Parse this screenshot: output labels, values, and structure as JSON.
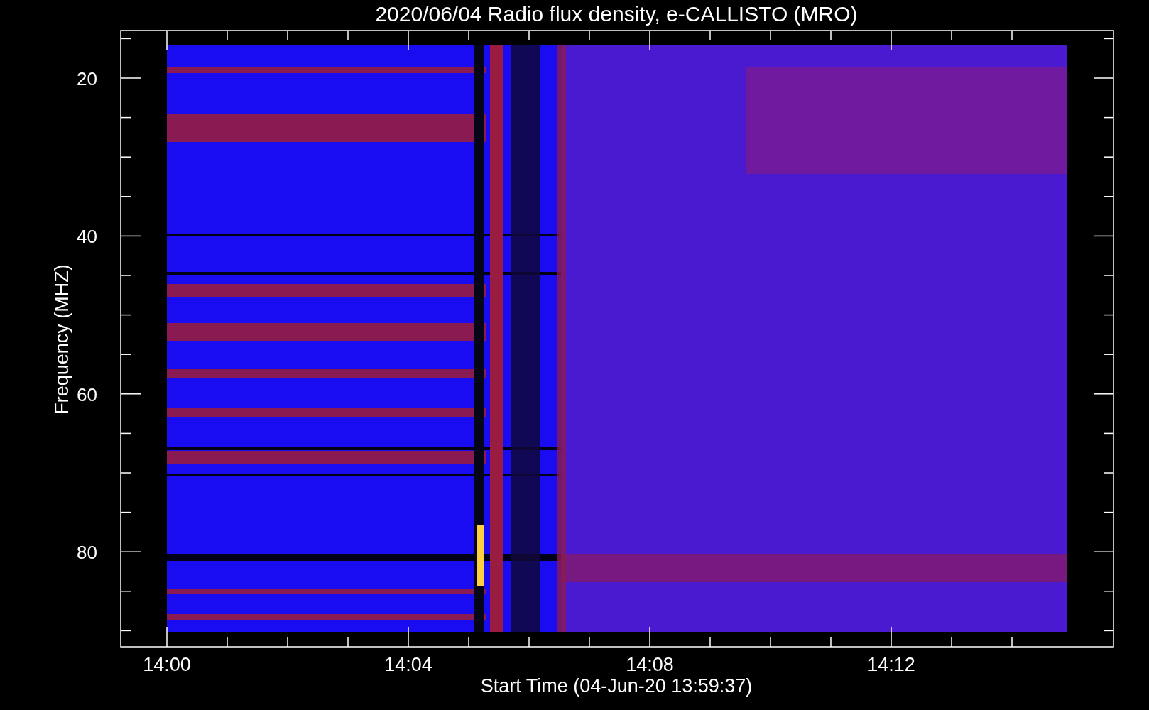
{
  "title": "2020/06/04  Radio flux density, e-CALLISTO (MRO)",
  "y_axis": {
    "label": "Frequency (MHZ)",
    "ticks": [
      "20",
      "40",
      "60",
      "80"
    ]
  },
  "x_axis": {
    "label": "Start Time (04-Jun-20 13:59:37)",
    "ticks": [
      "14:00",
      "14:04",
      "14:08",
      "14:12"
    ]
  }
}
